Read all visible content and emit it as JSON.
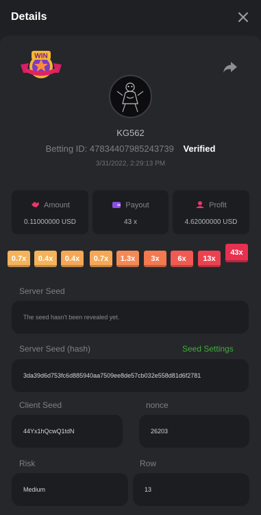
{
  "header": {
    "title": "Details"
  },
  "bet": {
    "username": "KG562",
    "betting_id_label": "Betting ID:",
    "betting_id_value": "47834407985243739",
    "verified": "Verified",
    "date": "3/31/2022, 2:29:13 PM"
  },
  "badge": {
    "text": "WIN"
  },
  "stats": {
    "amount": {
      "label": "Amount",
      "value": "0.11000000 USD"
    },
    "payout": {
      "label": "Payout",
      "value": "43 x"
    },
    "profit": {
      "label": "Profit",
      "value": "4.62000000 USD"
    }
  },
  "multipliers": [
    "0.7x",
    "0.4x",
    "0.4x",
    "0.7x",
    "1.3x",
    "3x",
    "6x",
    "13x",
    "43x"
  ],
  "multiplier_colors": [
    "#f5b35b",
    "#f5b35b",
    "#f5a856",
    "#f5a856",
    "#f38a55",
    "#f3794f",
    "#f05a52",
    "#ec4250",
    "#e8304f"
  ],
  "seed": {
    "server_seed_label": "Server Seed",
    "server_seed_value": "The seed hasn't been revealed yet.",
    "server_hash_label": "Server Seed (hash)",
    "seed_settings": "Seed Settings",
    "server_hash_value": "3da39d6d753fc6d885940aa7509ee8de57cb032e558d81d6f2781",
    "client_seed_label": "Client Seed",
    "client_seed_value": "44Yx1hQcwQ1tdN",
    "nonce_label": "nonce",
    "nonce_value": "26203",
    "risk_label": "Risk",
    "risk_value": "Medium",
    "row_label": "Row",
    "row_value": "13"
  },
  "colors": {
    "verified_text": "#ffffff",
    "seed_settings": "#3fae3a",
    "highlight": "#e8304f"
  }
}
